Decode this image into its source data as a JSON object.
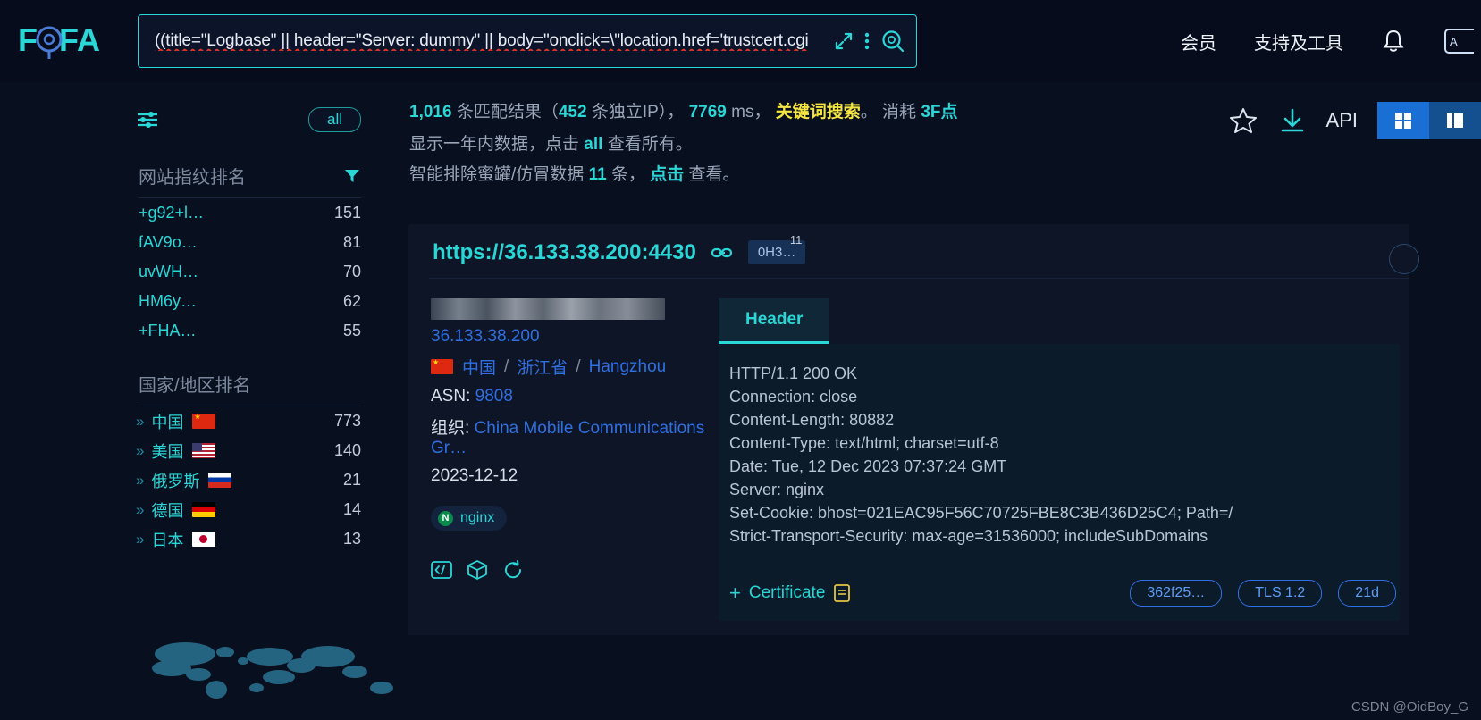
{
  "brand": {
    "logo_text": "FOFA"
  },
  "search": {
    "query": "((title=\"Logbase\" || header=\"Server: dummy\" || body=\"onclick=\\\"location.href='trustcert.cgi",
    "placeholder": "",
    "expand_icon": "expand-icon",
    "more_icon": "more-vertical-icon",
    "search_icon": "search-icon"
  },
  "nav": {
    "links": [
      {
        "label": "会员",
        "name": "nav-member"
      },
      {
        "label": "支持及工具",
        "name": "nav-support-tools"
      }
    ],
    "bell_icon": "bell-icon",
    "api_corner_icon": "api-badge-icon"
  },
  "sidebar": {
    "filter_icon": "sliders-icon",
    "all_label": "all",
    "fingerprint": {
      "title": "网站指纹排名",
      "funnel_icon": "funnel-icon",
      "rows": [
        {
          "label": "+g92+l…",
          "count": "151"
        },
        {
          "label": "fAV9o…",
          "count": "81"
        },
        {
          "label": "uvWH…",
          "count": "70"
        },
        {
          "label": "HM6y…",
          "count": "62"
        },
        {
          "label": "+FHA…",
          "count": "55"
        }
      ]
    },
    "country": {
      "title": "国家/地区排名",
      "rows": [
        {
          "label": "中国",
          "count": "773",
          "flag": "f-cn"
        },
        {
          "label": "美国",
          "count": "140",
          "flag": "f-us"
        },
        {
          "label": "俄罗斯",
          "count": "21",
          "flag": "f-ru"
        },
        {
          "label": "德国",
          "count": "14",
          "flag": "f-de"
        },
        {
          "label": "日本",
          "count": "13",
          "flag": "f-jp"
        }
      ]
    }
  },
  "summary": {
    "total": "1,016",
    "total_suffix": "条匹配结果（",
    "unique_ip": "452",
    "unique_suffix": "条独立IP），",
    "time_ms": "7769",
    "time_unit": "ms",
    "search_type": "关键词搜索",
    "consume_label": "消耗",
    "consume_value": "3F点",
    "line2_pre": "显示一年内数据，点击",
    "line2_link": "all",
    "line2_post": "查看所有。",
    "line3_pre": "智能排除蜜罐/仿冒数据",
    "line3_count": "11",
    "line3_mid": "条，",
    "line3_link": "点击",
    "line3_post": "查看。"
  },
  "toolbar": {
    "star_icon": "star-icon",
    "download_icon": "download-icon",
    "api_label": "API",
    "grid_view_icon": "grid-view-icon",
    "list_view_icon": "list-view-icon"
  },
  "result": {
    "url": "https://36.133.38.200:4430",
    "link_icon": "chain-link-icon",
    "badge": "0H3…",
    "badge_count": "11",
    "ip": "36.133.38.200",
    "country": "中国",
    "province": "浙江省",
    "city": "Hangzhou",
    "asn_label": "ASN:",
    "asn_value": "9808",
    "org_label": "组织:",
    "org_value": "China Mobile Communications Gr…",
    "date": "2023-12-12",
    "tech_tag": "nginx",
    "tech_badge_letter": "N",
    "action_icons": [
      "code-icon",
      "cube-icon",
      "refresh-icon"
    ],
    "tab_label": "Header",
    "header_lines": [
      "HTTP/1.1 200 OK",
      "Connection: close",
      "Content-Length: 80882",
      "Content-Type: text/html; charset=utf-8",
      "Date: Tue, 12 Dec 2023 07:37:24 GMT",
      "Server: nginx",
      "Set-Cookie: bhost=021EAC95F56C70725FBE8C3B436D25C4; Path=/",
      "Strict-Transport-Security: max-age=31536000; includeSubDomains"
    ],
    "certificate_label": "Certificate",
    "certificate_doc_icon": "document-icon",
    "pills": [
      {
        "label": "362f25…"
      },
      {
        "label": "TLS 1.2"
      },
      {
        "label": "21d"
      }
    ]
  },
  "watermark": "CSDN @OidBoy_G"
}
